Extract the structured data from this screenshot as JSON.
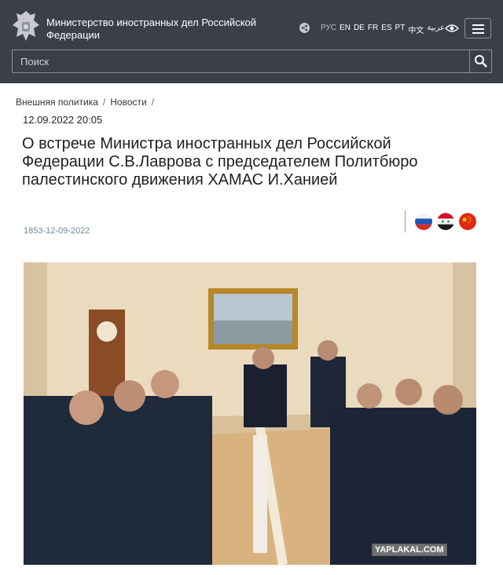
{
  "header": {
    "title": "Министерство иностранных дел Российской Федерации",
    "languages": [
      "РУС",
      "EN",
      "DE",
      "FR",
      "ES",
      "PT",
      "中文",
      "عربية"
    ],
    "icons": {
      "emblem": "emblem-icon",
      "share": "share-icon",
      "accessibility": "eye-icon",
      "menu": "menu-icon",
      "search": "search-icon"
    }
  },
  "search": {
    "placeholder": "Поиск"
  },
  "breadcrumb": [
    "Внешняя политика",
    "Новости"
  ],
  "article": {
    "date": "12.09.2022 20:05",
    "title": "О встрече Министра иностранных дел Российской Федерации С.В.Лаврова с председателем Политбюро палестинского движения ХАМАС И.Ханией",
    "number": "1853-12-09-2022",
    "flags": [
      "russia-flag-icon",
      "syria-flag-icon",
      "china-flag-icon"
    ]
  },
  "photo": {
    "watermark": "YAPLAKAL.COM"
  },
  "colors": {
    "header_bg": "#3a3f4a",
    "doc_number": "#6a8aa1",
    "page_bg": "#ffffff"
  }
}
